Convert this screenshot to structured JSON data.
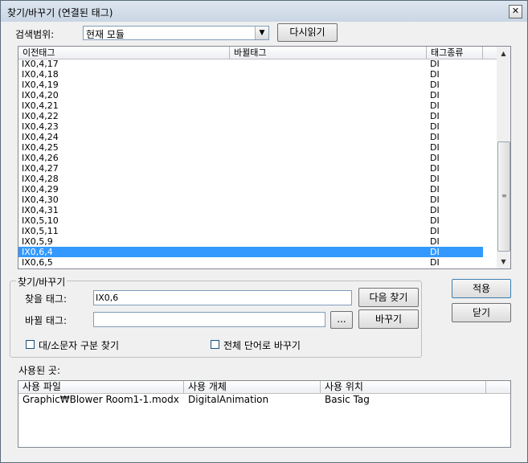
{
  "window": {
    "title": "찾기/바꾸기 (연결된 태그)",
    "close_glyph": "✕"
  },
  "search_scope": {
    "label": "검색범위:",
    "selected": "현재 모듈",
    "reload_label": "다시읽기"
  },
  "tag_list": {
    "columns": [
      "이전태그",
      "바뀔태그",
      "태그종류"
    ],
    "rows": [
      {
        "old": "IX0,4,17",
        "new": "",
        "type": "DI"
      },
      {
        "old": "IX0,4,18",
        "new": "",
        "type": "DI"
      },
      {
        "old": "IX0,4,19",
        "new": "",
        "type": "DI"
      },
      {
        "old": "IX0,4,20",
        "new": "",
        "type": "DI"
      },
      {
        "old": "IX0,4,21",
        "new": "",
        "type": "DI"
      },
      {
        "old": "IX0,4,22",
        "new": "",
        "type": "DI"
      },
      {
        "old": "IX0,4,23",
        "new": "",
        "type": "DI"
      },
      {
        "old": "IX0,4,24",
        "new": "",
        "type": "DI"
      },
      {
        "old": "IX0,4,25",
        "new": "",
        "type": "DI"
      },
      {
        "old": "IX0,4,26",
        "new": "",
        "type": "DI"
      },
      {
        "old": "IX0,4,27",
        "new": "",
        "type": "DI"
      },
      {
        "old": "IX0,4,28",
        "new": "",
        "type": "DI"
      },
      {
        "old": "IX0,4,29",
        "new": "",
        "type": "DI"
      },
      {
        "old": "IX0,4,30",
        "new": "",
        "type": "DI"
      },
      {
        "old": "IX0,4,31",
        "new": "",
        "type": "DI"
      },
      {
        "old": "IX0,5,10",
        "new": "",
        "type": "DI"
      },
      {
        "old": "IX0,5,11",
        "new": "",
        "type": "DI"
      },
      {
        "old": "IX0,5,9",
        "new": "",
        "type": "DI"
      },
      {
        "old": "IX0,6,4",
        "new": "",
        "type": "DI",
        "selected": true
      },
      {
        "old": "IX0,6,5",
        "new": "",
        "type": "DI"
      }
    ]
  },
  "find_replace": {
    "group_label": "찾기/바꾸기",
    "find_label": "찾을 태그:",
    "find_value": "IX0,6",
    "next_label": "다음 찾기",
    "replace_label": "바뀔 태그:",
    "replace_value": "",
    "browse_label": "...",
    "replace_button_label": "바꾸기",
    "case_label": "대/소문자 구분 찾기",
    "whole_word_label": "전체 단어로 바꾸기"
  },
  "actions": {
    "apply_label": "적용",
    "close_label": "닫기"
  },
  "usage": {
    "label": "사용된 곳:",
    "columns": [
      "사용 파일",
      "사용 개체",
      "사용 위치"
    ],
    "rows": [
      {
        "file": "Graphic₩Blower Room1-1.modx",
        "object": "DigitalAnimation",
        "location": "Basic Tag"
      }
    ]
  }
}
